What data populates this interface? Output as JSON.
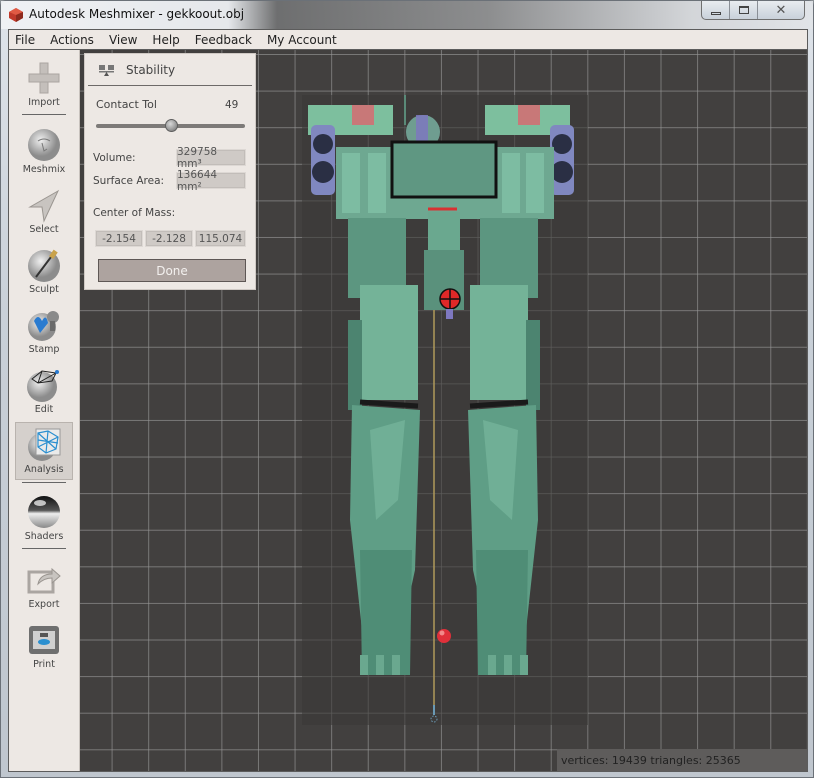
{
  "window": {
    "title": "Autodesk Meshmixer - gekkoout.obj",
    "controls": {
      "minimize": "minimize-icon",
      "maximize": "maximize-icon",
      "close": "close-icon"
    }
  },
  "menu": [
    "File",
    "Actions",
    "View",
    "Help",
    "Feedback",
    "My Account"
  ],
  "toolbar": {
    "items": [
      {
        "label": "Import",
        "icon": "plus-icon"
      },
      {
        "label": "Meshmix",
        "icon": "face-sphere-icon"
      },
      {
        "label": "Select",
        "icon": "arrow-cursor-icon"
      },
      {
        "label": "Sculpt",
        "icon": "brush-sphere-icon"
      },
      {
        "label": "Stamp",
        "icon": "stamp-icon"
      },
      {
        "label": "Edit",
        "icon": "wireframe-sphere-icon"
      },
      {
        "label": "Analysis",
        "icon": "analysis-mesh-icon",
        "active": true
      },
      {
        "label": "Shaders",
        "icon": "chrome-sphere-icon"
      },
      {
        "label": "Export",
        "icon": "export-icon"
      },
      {
        "label": "Print",
        "icon": "printer-icon"
      }
    ]
  },
  "stability_panel": {
    "title": "Stability",
    "icon": "stability-icon",
    "contact_tol": {
      "label": "Contact Tol",
      "value": "49",
      "slider_fraction": 0.49
    },
    "volume": {
      "label": "Volume:",
      "value": "329758 mm³"
    },
    "surface_area": {
      "label": "Surface Area:",
      "value": "136644 mm²"
    },
    "center_of_mass": {
      "label": "Center of Mass:",
      "x": "-2.154",
      "y": "-2.128",
      "z": "115.074"
    },
    "done_label": "Done"
  },
  "status": {
    "text": "vertices: 19439 triangles: 25365"
  },
  "colors": {
    "viewport_bg": "#42403f",
    "grid": "#969696",
    "panel_bg": "#ede8e4",
    "model_green": "#6aa88f",
    "center_of_mass_marker": "#e02828",
    "plumb_line": "#b09a5a"
  }
}
